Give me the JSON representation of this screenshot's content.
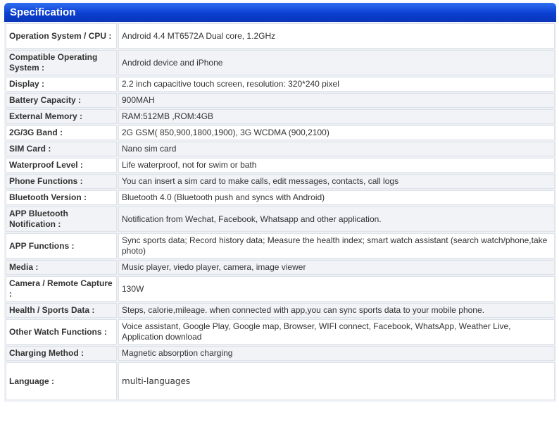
{
  "title": "Specification",
  "rows": [
    {
      "label": "Operation System / CPU :",
      "value": "Android 4.4 MT6572A Dual core, 1.2GHz"
    },
    {
      "label": "Compatible Operating System :",
      "value": "Android device and iPhone"
    },
    {
      "label": "Display :",
      "value": "2.2 inch capacitive touch screen, resolution: 320*240 pixel"
    },
    {
      "label": "Battery Capacity :",
      "value": "900MAH"
    },
    {
      "label": "External Memory :",
      "value": "RAM:512MB ,ROM:4GB"
    },
    {
      "label": "2G/3G Band :",
      "value": "2G GSM( 850,900,1800,1900), 3G WCDMA (900,2100)"
    },
    {
      "label": "SIM Card :",
      "value": "Nano sim card"
    },
    {
      "label": "Waterproof Level :",
      "value": "Life waterproof, not for swim or bath"
    },
    {
      "label": "Phone Functions :",
      "value": "You can insert a sim card to make calls, edit messages, contacts, call logs"
    },
    {
      "label": "Bluetooth Version :",
      "value": "Bluetooth 4.0 (Bluetooth push and syncs with Android)"
    },
    {
      "label": "APP Bluetooth Notification :",
      "value": "Notification from Wechat, Facebook, Whatsapp and other application."
    },
    {
      "label": "APP Functions :",
      "value": "Sync sports data; Record history data; Measure the health index; smart watch assistant (search watch/phone,take photo)"
    },
    {
      "label": "Media :",
      "value": "Music player, viedo player, camera, image viewer"
    },
    {
      "label": "Camera / Remote Capture :",
      "value": "130W"
    },
    {
      "label": "Health / Sports Data :",
      "value": "Steps, calorie,mileage. when connected with app,you can sync sports data to your mobile phone."
    },
    {
      "label": "Other Watch Functions :",
      "value": "Voice assistant, Google Play, Google map, Browser, WIFI connect, Facebook, WhatsApp, Weather Live, Application download"
    },
    {
      "label": "Charging Method :",
      "value": "Magnetic absorption charging"
    },
    {
      "label": "Language :",
      "value": "multi-languages"
    }
  ]
}
